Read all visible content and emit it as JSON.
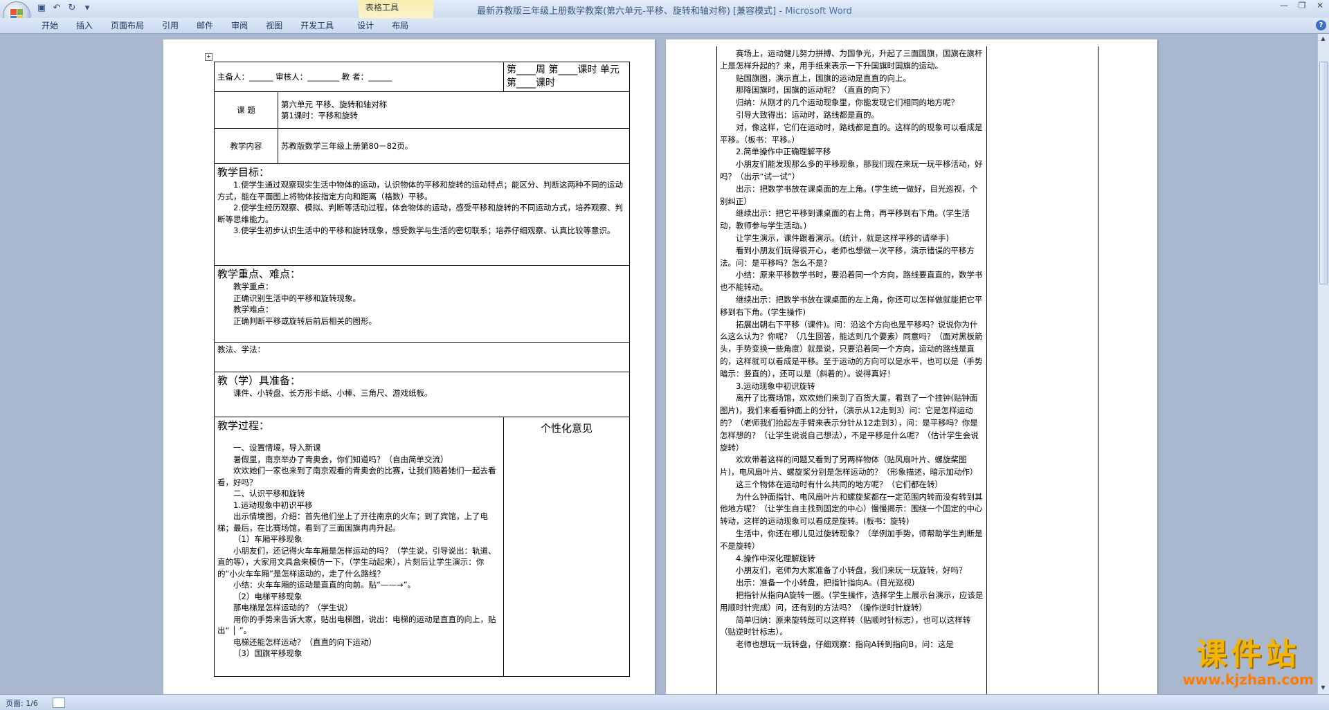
{
  "window": {
    "title": "最新苏教版三年级上册数学教案(第六单元-平移、旋转和轴对称) [兼容模式]",
    "app": "Microsoft Word",
    "context_group": "表格工具"
  },
  "ribbon_tabs": [
    "开始",
    "插入",
    "页面布局",
    "引用",
    "邮件",
    "审阅",
    "视图",
    "开发工具",
    "设计",
    "布局"
  ],
  "page1": {
    "header_left": "主备人：______ 审核人：________  教  者：______",
    "header_right": "第____周 第____课时 单元第____课时",
    "topic_label": "课   题",
    "topic_lines": [
      "第六单元 平移、旋转和轴对称",
      "第1课时：平移和旋转"
    ],
    "content_label": "教学内容",
    "content_value": "苏教版数学三年级上册第80－82页。",
    "goals_heading": "教学目标：",
    "goals": [
      "1.使学生通过观察现实生活中物体的运动，认识物体的平移和旋转的运动特点；能区分、判断这两种不同的运动方式，能在平面图上将物体按指定方向和距离（格数）平移。",
      "2.使学生经历观察、模拟、判断等活动过程，体会物体的运动，感受平移和旋转的不同运动方式，培养观察、判断等思维能力。",
      "3.使学生初步认识生活中的平移和旋转现象，感受数学与生活的密切联系；培养仔细观察、认真比较等意识。"
    ],
    "key_heading": "教学重点、难点：",
    "key_lines": [
      "教学重点：",
      "正确识别生活中的平移和旋转现象。",
      "教学难点：",
      "正确判断平移或旋转后前后相关的图形。"
    ],
    "method_heading": "教法、学法：",
    "tools_heading": "教（学）具准备：",
    "tools_value": "课件、小转盘、长方形卡纸、小棒、三角尺、游戏纸板。",
    "process_heading": "教学过程：",
    "opinion_heading": "个性化意见",
    "process": [
      "一、设置情境，导入新课",
      "暑假里，南京举办了青奥会，你们知道吗？（自由简单交流）",
      "欢欢她们一家也来到了南京观看的青奥会的比赛，让我们随着她们一起去看看，好吗？",
      "二、认识平移和旋转",
      "1.运动现象中初识平移",
      "出示情境图，介绍：首先他们坐上了开往南京的火车；到了宾馆，上了电梯；最后，在比赛场馆，看到了三面国旗冉冉升起。",
      "（1）车厢平移现象",
      "小朋友们，还记得火车车厢是怎样运动的吗？（学生说，引导说出：轨道、直的等），大家用文具盒来模仿一下，（学生动起来），片刻后让学生演示：你的“小火车车厢”是怎样运动的，走了什么路线？",
      "小结：火车车厢的运动是直直的向前。贴“——→”。",
      "（2）电梯平移现象",
      "那电梯是怎样运动的？（学生说）",
      "用你的手势来告诉大家，贴出电梯图，说出：电梯的运动是直直的向上，贴出“ │ ”。",
      "电梯还能怎样运动？（直直的向下运动）",
      "（3）国旗平移现象"
    ]
  },
  "page2": {
    "lines": [
      "赛场上，运动健儿努力拼搏、为国争光，升起了三面国旗，国旗在旗杆上是怎样升起的？来，用手纸来表示一下升国旗时国旗的运动。",
      "贴国旗图，演示直上，国旗的运动是直直的向上。",
      "那降国旗时，国旗的运动呢？（直直的向下）",
      "归纳：从刚才的几个运动现象里，你能发现它们相同的地方呢？",
      "引导大致得出：运动时，路线都是直的。",
      "对，像这样，它们在运动时，路线都是直的。这样的的现象可以看成是平移。（板书：平移。）",
      "2.简单操作中正确理解平移",
      "小朋友们能发现那么多的平移现象，那我们现在来玩一玩平移活动，好吗？（出示“试一试”）",
      "出示：把数学书放在课桌面的左上角。(学生统一做好，目光巡视，个别纠正）",
      "继续出示：把它平移到课桌面的右上角，再平移到右下角。(学生活动，教师参与学生活动。)",
      "让学生演示，课件跟着演示。(统计，就是这样平移的请举手)",
      "看到小朋友们玩得很开心，老师也想做一次平移，演示错误的平移方法。问：是平移吗？怎么不是？",
      "小结：原来平移数学书时，要沿着同一个方向，路线要直直的，数学书也不能转动。",
      "继续出示：把数学书放在课桌面的左上角，你还可以怎样做就能把它平移到右下角。(学生操作)",
      "拓展出朝右下平移（课件)。问：沿这个方向也是平移吗？说说你为什么这么认为？你呢？（几生回答，能达到几个要素）同意吗？（面对黑板箭头，手势变换一些角度）就是说，只要沿着同一个方向，运动的路线是直的，这样就可以看成是平移。至于运动的方向可以是水平，也可以是（手势暗示：竖直的），还可以是（斜着的）。说得真好！",
      "3.运动现象中初识旋转",
      "离开了比赛场馆，欢欢她们来到了百货大厦，看到了一个挂钟(贴钟面图片)，我们来看看钟面上的分针，（演示从12走到3）问：它是怎样运动的？（老师我们抬起左手臂来表示分针从12走到3），问：是平移吗？你是怎样想的？（让学生说说自己想法），不是平移是什么呢？（估计学生会说旋转）",
      "欢欢带着这样的问题又看到了另两样物体（贴风扇叶片、螺旋桨图片)，电风扇叶片、螺旋桨分别是怎样运动的？（形象描述，暗示加动作）",
      "这三个物体在运动时有什么共同的地方呢？（它们都在转）",
      "为什么钟面指针、电风扇叶片和螺旋桨都在一定范围内转而没有转到其他地方呢？（让学生自主找到固定的中心）慢慢揭示：围绕一个固定的中心转动，这样的运动现象可以看成是旋转。(板书：旋转)",
      "生活中，你还在哪儿见过旋转现象？（举例加手势，师帮助学生判断是不是旋转）",
      "4.操作中深化理解旋转",
      "小朋友们，老师为大家准备了小转盘，我们来玩一玩旋转，好吗？",
      "出示：准备一个小转盘，把指针指向A。(目光巡视)",
      "把指针从指向A旋转一圈。(学生操作，选择学生上展示台演示，应该是用顺时针完成）问，还有别的方法吗？（操作逆时针旋转）",
      "简单归纳：原来旋转既可以这样转（贴顺时针标志），也可以这样转（贴逆时针标志）。",
      "老师也想玩一玩转盘，仔细观察：指向A转到指向B，问：这是"
    ]
  },
  "status": {
    "page_label": "页面: 1/6"
  },
  "watermark": {
    "cn": "课件站",
    "url": "www.kjzhan.com"
  }
}
